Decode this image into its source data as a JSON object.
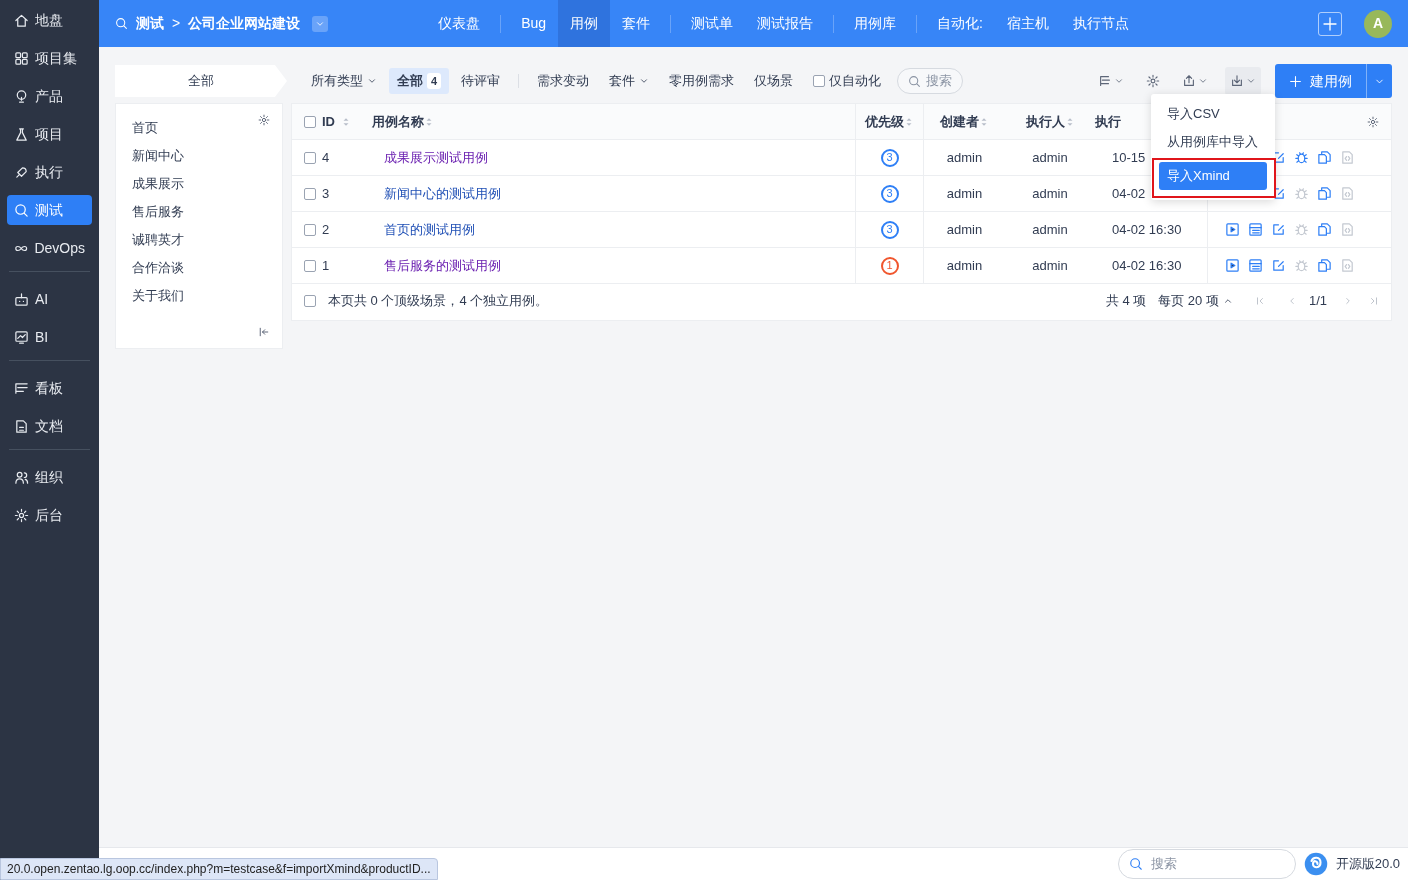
{
  "sidebar": {
    "groups": [
      [
        {
          "label": "地盘",
          "selected": false
        },
        {
          "label": "项目集",
          "selected": false
        },
        {
          "label": "产品",
          "selected": false
        },
        {
          "label": "项目",
          "selected": false
        },
        {
          "label": "执行",
          "selected": false
        },
        {
          "label": "测试",
          "selected": true
        },
        {
          "label": "DevOps",
          "selected": false
        }
      ],
      [
        {
          "label": "AI",
          "selected": false
        },
        {
          "label": "BI",
          "selected": false
        }
      ],
      [
        {
          "label": "看板",
          "selected": false
        },
        {
          "label": "文档",
          "selected": false
        }
      ],
      [
        {
          "label": "组织",
          "selected": false
        },
        {
          "label": "后台",
          "selected": false
        }
      ]
    ]
  },
  "header": {
    "section": "测试",
    "separator": ">",
    "project": "公司企业网站建设",
    "nav_groups": [
      [
        {
          "label": "仪表盘",
          "selected": false
        }
      ],
      [
        {
          "label": "Bug",
          "selected": false
        },
        {
          "label": "用例",
          "selected": true
        },
        {
          "label": "套件",
          "selected": false
        }
      ],
      [
        {
          "label": "测试单",
          "selected": false
        },
        {
          "label": "测试报告",
          "selected": false
        }
      ],
      [
        {
          "label": "用例库",
          "selected": false
        }
      ],
      [
        {
          "label": "自动化:",
          "selected": false
        },
        {
          "label": "宿主机",
          "selected": false
        },
        {
          "label": "执行节点",
          "selected": false
        }
      ]
    ],
    "avatar": "A"
  },
  "toolbar": {
    "module_tab": "全部",
    "filters": [
      {
        "kind": "dropdown",
        "label": "所有类型",
        "selected": false
      },
      {
        "kind": "tab",
        "label": "全部",
        "count": "4",
        "selected": true
      },
      {
        "kind": "tab",
        "label": "待评审",
        "selected": false
      },
      {
        "kind": "divider"
      },
      {
        "kind": "tab",
        "label": "需求变动",
        "selected": false
      },
      {
        "kind": "dropdown",
        "label": "套件",
        "selected": false
      },
      {
        "kind": "tab",
        "label": "零用例需求",
        "selected": false
      },
      {
        "kind": "tab",
        "label": "仅场景",
        "selected": false
      },
      {
        "kind": "checkbox",
        "label": "仅自动化",
        "checked": false
      }
    ],
    "search_placeholder": "搜索",
    "create_button": "建用例"
  },
  "modules": {
    "items": [
      "首页",
      "新闻中心",
      "成果展示",
      "售后服务",
      "诚聘英才",
      "合作洽谈",
      "关于我们"
    ]
  },
  "table": {
    "all_checked": false,
    "columns": [
      "ID",
      "用例名称",
      "优先级",
      "创建者",
      "执行人",
      "执行"
    ],
    "rows": [
      {
        "checked": false,
        "id": "4",
        "name": "成果展示测试用例",
        "visited": true,
        "priority": {
          "text": "3",
          "color": "#2e7ff6"
        },
        "creator": "admin",
        "executor": "admin",
        "time": "10-15",
        "actions": [
          {
            "kind": "edit",
            "disabled": false
          },
          {
            "kind": "bug",
            "disabled": false
          },
          {
            "kind": "copy",
            "disabled": false
          },
          {
            "kind": "script",
            "disabled": true
          }
        ]
      },
      {
        "checked": false,
        "id": "3",
        "name": "新闻中心的测试用例",
        "visited": false,
        "priority": {
          "text": "3",
          "color": "#2e7ff6"
        },
        "creator": "admin",
        "executor": "admin",
        "time": "04-02",
        "actions": [
          {
            "kind": "edit",
            "disabled": false
          },
          {
            "kind": "bug",
            "disabled": true
          },
          {
            "kind": "copy",
            "disabled": false
          },
          {
            "kind": "script",
            "disabled": true
          }
        ]
      },
      {
        "checked": false,
        "id": "2",
        "name": "首页的测试用例",
        "visited": false,
        "priority": {
          "text": "3",
          "color": "#2e7ff6"
        },
        "creator": "admin",
        "executor": "admin",
        "time": "04-02 16:30",
        "actions": [
          {
            "kind": "run",
            "disabled": false
          },
          {
            "kind": "cases",
            "disabled": false
          },
          {
            "kind": "edit",
            "disabled": false
          },
          {
            "kind": "bug",
            "disabled": true
          },
          {
            "kind": "copy",
            "disabled": false
          },
          {
            "kind": "script",
            "disabled": true
          }
        ]
      },
      {
        "checked": false,
        "id": "1",
        "name": "售后服务的测试用例",
        "visited": true,
        "priority": {
          "text": "1",
          "color": "#f0562e"
        },
        "creator": "admin",
        "executor": "admin",
        "time": "04-02 16:30",
        "actions": [
          {
            "kind": "run",
            "disabled": false
          },
          {
            "kind": "cases",
            "disabled": false
          },
          {
            "kind": "edit",
            "disabled": false
          },
          {
            "kind": "bug",
            "disabled": true
          },
          {
            "kind": "copy",
            "disabled": false
          },
          {
            "kind": "script",
            "disabled": true
          }
        ]
      }
    ],
    "page_checked": false,
    "summary": "本页共 0 个顶级场景，4 个独立用例。",
    "pager": {
      "total": "共 4 项",
      "per_page": "每页 20 项",
      "page": "1/1"
    }
  },
  "import_menu": {
    "items": [
      {
        "label": "导入CSV",
        "selected": false,
        "annotated": false
      },
      {
        "label": "从用例库中导入",
        "selected": false,
        "annotated": false
      },
      {
        "label": "导入Xmind",
        "selected": true,
        "annotated": true
      }
    ]
  },
  "footer": {
    "search_placeholder": "搜索",
    "edition": "开源版20.0"
  },
  "status_url": "20.0.open.zentao.lg.oop.cc/index.php?m=testcase&f=importXmind&productID..."
}
